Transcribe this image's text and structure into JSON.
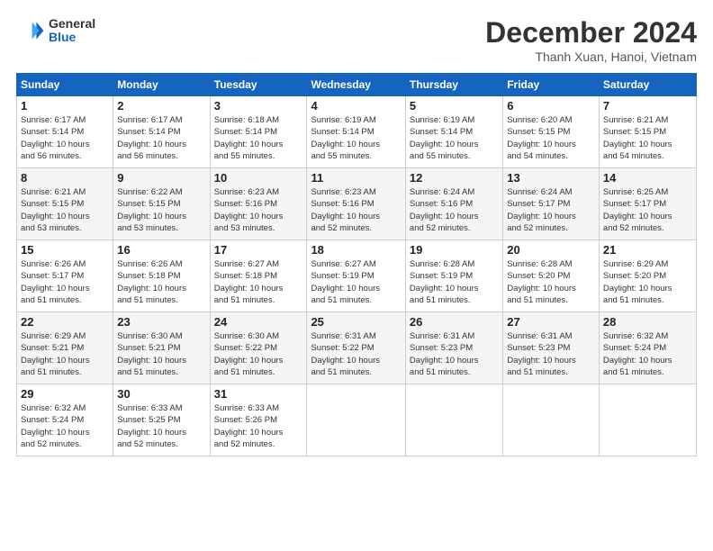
{
  "logo": {
    "general": "General",
    "blue": "Blue"
  },
  "title": {
    "month": "December 2024",
    "location": "Thanh Xuan, Hanoi, Vietnam"
  },
  "weekdays": [
    "Sunday",
    "Monday",
    "Tuesday",
    "Wednesday",
    "Thursday",
    "Friday",
    "Saturday"
  ],
  "weeks": [
    [
      {
        "day": 1,
        "info": "Sunrise: 6:17 AM\nSunset: 5:14 PM\nDaylight: 10 hours\nand 56 minutes."
      },
      {
        "day": 2,
        "info": "Sunrise: 6:17 AM\nSunset: 5:14 PM\nDaylight: 10 hours\nand 56 minutes."
      },
      {
        "day": 3,
        "info": "Sunrise: 6:18 AM\nSunset: 5:14 PM\nDaylight: 10 hours\nand 55 minutes."
      },
      {
        "day": 4,
        "info": "Sunrise: 6:19 AM\nSunset: 5:14 PM\nDaylight: 10 hours\nand 55 minutes."
      },
      {
        "day": 5,
        "info": "Sunrise: 6:19 AM\nSunset: 5:14 PM\nDaylight: 10 hours\nand 55 minutes."
      },
      {
        "day": 6,
        "info": "Sunrise: 6:20 AM\nSunset: 5:15 PM\nDaylight: 10 hours\nand 54 minutes."
      },
      {
        "day": 7,
        "info": "Sunrise: 6:21 AM\nSunset: 5:15 PM\nDaylight: 10 hours\nand 54 minutes."
      }
    ],
    [
      {
        "day": 8,
        "info": "Sunrise: 6:21 AM\nSunset: 5:15 PM\nDaylight: 10 hours\nand 53 minutes."
      },
      {
        "day": 9,
        "info": "Sunrise: 6:22 AM\nSunset: 5:15 PM\nDaylight: 10 hours\nand 53 minutes."
      },
      {
        "day": 10,
        "info": "Sunrise: 6:23 AM\nSunset: 5:16 PM\nDaylight: 10 hours\nand 53 minutes."
      },
      {
        "day": 11,
        "info": "Sunrise: 6:23 AM\nSunset: 5:16 PM\nDaylight: 10 hours\nand 52 minutes."
      },
      {
        "day": 12,
        "info": "Sunrise: 6:24 AM\nSunset: 5:16 PM\nDaylight: 10 hours\nand 52 minutes."
      },
      {
        "day": 13,
        "info": "Sunrise: 6:24 AM\nSunset: 5:17 PM\nDaylight: 10 hours\nand 52 minutes."
      },
      {
        "day": 14,
        "info": "Sunrise: 6:25 AM\nSunset: 5:17 PM\nDaylight: 10 hours\nand 52 minutes."
      }
    ],
    [
      {
        "day": 15,
        "info": "Sunrise: 6:26 AM\nSunset: 5:17 PM\nDaylight: 10 hours\nand 51 minutes."
      },
      {
        "day": 16,
        "info": "Sunrise: 6:26 AM\nSunset: 5:18 PM\nDaylight: 10 hours\nand 51 minutes."
      },
      {
        "day": 17,
        "info": "Sunrise: 6:27 AM\nSunset: 5:18 PM\nDaylight: 10 hours\nand 51 minutes."
      },
      {
        "day": 18,
        "info": "Sunrise: 6:27 AM\nSunset: 5:19 PM\nDaylight: 10 hours\nand 51 minutes."
      },
      {
        "day": 19,
        "info": "Sunrise: 6:28 AM\nSunset: 5:19 PM\nDaylight: 10 hours\nand 51 minutes."
      },
      {
        "day": 20,
        "info": "Sunrise: 6:28 AM\nSunset: 5:20 PM\nDaylight: 10 hours\nand 51 minutes."
      },
      {
        "day": 21,
        "info": "Sunrise: 6:29 AM\nSunset: 5:20 PM\nDaylight: 10 hours\nand 51 minutes."
      }
    ],
    [
      {
        "day": 22,
        "info": "Sunrise: 6:29 AM\nSunset: 5:21 PM\nDaylight: 10 hours\nand 51 minutes."
      },
      {
        "day": 23,
        "info": "Sunrise: 6:30 AM\nSunset: 5:21 PM\nDaylight: 10 hours\nand 51 minutes."
      },
      {
        "day": 24,
        "info": "Sunrise: 6:30 AM\nSunset: 5:22 PM\nDaylight: 10 hours\nand 51 minutes."
      },
      {
        "day": 25,
        "info": "Sunrise: 6:31 AM\nSunset: 5:22 PM\nDaylight: 10 hours\nand 51 minutes."
      },
      {
        "day": 26,
        "info": "Sunrise: 6:31 AM\nSunset: 5:23 PM\nDaylight: 10 hours\nand 51 minutes."
      },
      {
        "day": 27,
        "info": "Sunrise: 6:31 AM\nSunset: 5:23 PM\nDaylight: 10 hours\nand 51 minutes."
      },
      {
        "day": 28,
        "info": "Sunrise: 6:32 AM\nSunset: 5:24 PM\nDaylight: 10 hours\nand 51 minutes."
      }
    ],
    [
      {
        "day": 29,
        "info": "Sunrise: 6:32 AM\nSunset: 5:24 PM\nDaylight: 10 hours\nand 52 minutes."
      },
      {
        "day": 30,
        "info": "Sunrise: 6:33 AM\nSunset: 5:25 PM\nDaylight: 10 hours\nand 52 minutes."
      },
      {
        "day": 31,
        "info": "Sunrise: 6:33 AM\nSunset: 5:26 PM\nDaylight: 10 hours\nand 52 minutes."
      },
      null,
      null,
      null,
      null
    ]
  ]
}
